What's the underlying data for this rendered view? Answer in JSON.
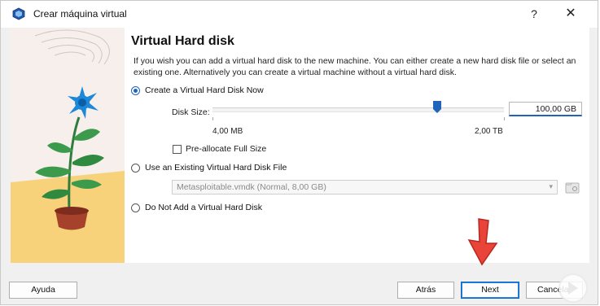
{
  "window": {
    "title": "Crear máquina virtual",
    "help": "?",
    "close": "✕"
  },
  "page": {
    "heading": "Virtual Hard disk",
    "description": "If you wish you can add a virtual hard disk to the new machine. You can either create a new hard disk file or select an existing one. Alternatively you can create a virtual machine without a virtual hard disk."
  },
  "options": {
    "create_now": {
      "label": "Create a Virtual Hard Disk Now",
      "checked": true
    },
    "use_existing": {
      "label": "Use an Existing Virtual Hard Disk File",
      "checked": false
    },
    "do_not_add": {
      "label": "Do Not Add a Virtual Hard Disk",
      "checked": false
    }
  },
  "disk_size": {
    "label": "Disk Size:",
    "value": "100,00 GB",
    "min_label": "4,00 MB",
    "max_label": "2,00 TB",
    "slider_fraction": 0.77
  },
  "preallocate": {
    "label": "Pre-allocate Full Size",
    "checked": false
  },
  "existing_file": {
    "selected": "Metasploitable.vmdk (Normal, 8,00 GB)"
  },
  "footer": {
    "help": "Ayuda",
    "back": "Atrás",
    "next": "Next",
    "cancel": "Cancelar"
  },
  "colors": {
    "accent": "#1f64b8",
    "arrow": "#e8443a",
    "plant_pot": "#a6412b",
    "flower": "#1e88d8"
  }
}
